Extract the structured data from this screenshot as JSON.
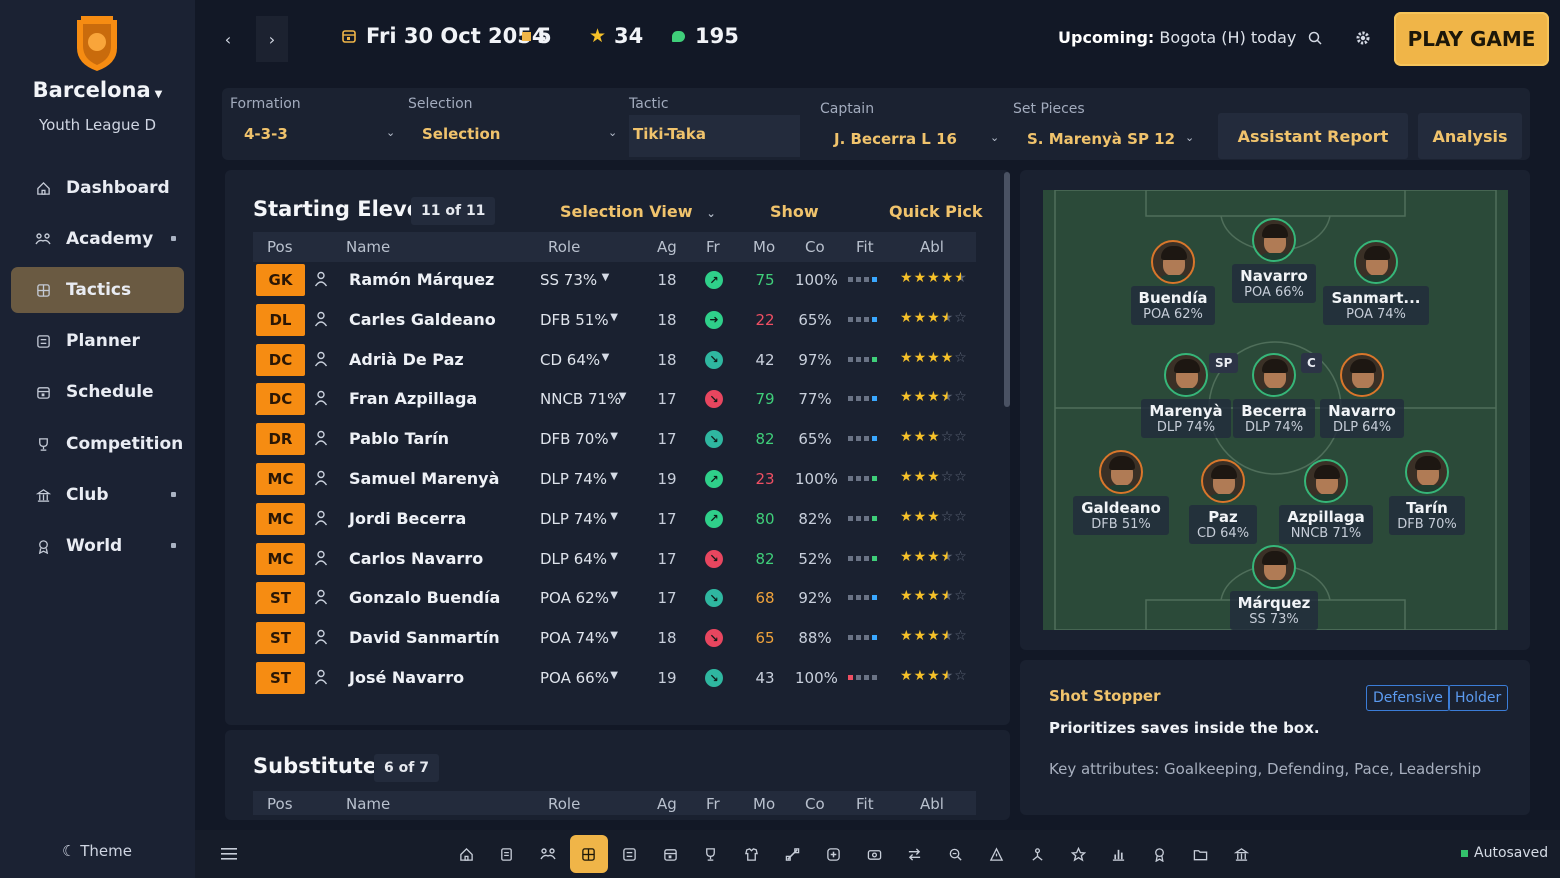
{
  "sidebar": {
    "club_name": "Barcelona",
    "league": "Youth League D",
    "nav": [
      {
        "label": "Dashboard",
        "icon": "home-icon",
        "active": false,
        "dot": false
      },
      {
        "label": "Academy",
        "icon": "academy-icon",
        "active": false,
        "dot": true
      },
      {
        "label": "Tactics",
        "icon": "tactics-icon",
        "active": true,
        "dot": false
      },
      {
        "label": "Planner",
        "icon": "planner-icon",
        "active": false,
        "dot": false
      },
      {
        "label": "Schedule",
        "icon": "calendar-icon",
        "active": false,
        "dot": false
      },
      {
        "label": "Competition",
        "icon": "trophy-icon",
        "active": false,
        "dot": false
      },
      {
        "label": "Club",
        "icon": "club-icon",
        "active": false,
        "dot": true
      },
      {
        "label": "World",
        "icon": "world-icon",
        "active": false,
        "dot": true
      }
    ],
    "theme_label": "Theme"
  },
  "topbar": {
    "date": "Fri 30 Oct 2054",
    "stat_squares": "5",
    "stat_stars": "34",
    "stat_coins": "195",
    "upcoming_label": "Upcoming:",
    "upcoming_value": "Bogota (H) today",
    "play_label": "PLAY GAME"
  },
  "toolbar": {
    "formation_label": "Formation",
    "formation_value": "4-3-3",
    "selection_label": "Selection",
    "selection_value": "Selection",
    "tactic_label": "Tactic",
    "tactic_value": "Tiki-Taka",
    "captain_label": "Captain",
    "captain_value": "J. Becerra  L 16",
    "setpieces_label": "Set Pieces",
    "setpieces_value": "S. Marenyà  SP 12",
    "assistant_label": "Assistant Report",
    "analysis_label": "Analysis"
  },
  "starting": {
    "title": "Starting Eleven",
    "count": "11 of 11",
    "selection_view": "Selection View",
    "show": "Show",
    "quick_pick": "Quick Pick",
    "columns": [
      "Pos",
      "Name",
      "Role",
      "Ag",
      "Fr",
      "Mo",
      "Co",
      "Fit",
      "Abl"
    ],
    "rows": [
      {
        "pos": "GK",
        "name": "Ramón Márquez",
        "role": "SS 73%",
        "age": "18",
        "form": "up",
        "morale": "75",
        "morale_color": "#3fcf7a",
        "cond": "100%",
        "fit_color": "#3aa8ff",
        "stars": 4.5
      },
      {
        "pos": "DL",
        "name": "Carles Galdeano",
        "role": "DFB 51%",
        "age": "18",
        "form": "right",
        "morale": "22",
        "morale_color": "#ef4f63",
        "cond": "65%",
        "fit_color": "#3aa8ff",
        "stars": 3.5
      },
      {
        "pos": "DC",
        "name": "Adrià De Paz",
        "role": "CD 64%",
        "age": "18",
        "form": "down-right",
        "morale": "42",
        "morale_color": "#c9d0dc",
        "cond": "97%",
        "fit_color": "#3fcf7a",
        "stars": 4
      },
      {
        "pos": "DC",
        "name": "Fran Azpillaga",
        "role": "NNCB 71%",
        "age": "17",
        "form": "down",
        "morale": "79",
        "morale_color": "#3fcf7a",
        "cond": "77%",
        "fit_color": "#3aa8ff",
        "stars": 3.5
      },
      {
        "pos": "DR",
        "name": "Pablo Tarín",
        "role": "DFB 70%",
        "age": "17",
        "form": "down-right",
        "morale": "82",
        "morale_color": "#3fcf7a",
        "cond": "65%",
        "fit_color": "#3aa8ff",
        "stars": 3
      },
      {
        "pos": "MC",
        "name": "Samuel Marenyà",
        "role": "DLP 74%",
        "age": "19",
        "form": "up",
        "morale": "23",
        "morale_color": "#ef4f63",
        "cond": "100%",
        "fit_color": "#3fcf7a",
        "stars": 3
      },
      {
        "pos": "MC",
        "name": "Jordi Becerra",
        "role": "DLP 74%",
        "age": "17",
        "form": "up",
        "morale": "80",
        "morale_color": "#3fcf7a",
        "cond": "82%",
        "fit_color": "#3fcf7a",
        "stars": 3
      },
      {
        "pos": "MC",
        "name": "Carlos Navarro",
        "role": "DLP 64%",
        "age": "17",
        "form": "down",
        "morale": "82",
        "morale_color": "#3fcf7a",
        "cond": "52%",
        "fit_color": "#3fcf7a",
        "stars": 3.5
      },
      {
        "pos": "ST",
        "name": "Gonzalo Buendía",
        "role": "POA 62%",
        "age": "17",
        "form": "down-right",
        "morale": "68",
        "morale_color": "#f0a33b",
        "cond": "92%",
        "fit_color": "#3aa8ff",
        "stars": 3.5
      },
      {
        "pos": "ST",
        "name": "David Sanmartín",
        "role": "POA 74%",
        "age": "18",
        "form": "down",
        "morale": "65",
        "morale_color": "#f0a33b",
        "cond": "88%",
        "fit_color": "#3aa8ff",
        "stars": 3.5
      },
      {
        "pos": "ST",
        "name": "José Navarro",
        "role": "POA 66%",
        "age": "19",
        "form": "down-right",
        "morale": "43",
        "morale_color": "#c9d0dc",
        "cond": "100%",
        "fit_color": "#ef4f63",
        "stars": 3.5
      }
    ]
  },
  "substitutes": {
    "title": "Substitutes",
    "count": "6 of 7",
    "columns": [
      "Pos",
      "Name",
      "Role",
      "Ag",
      "Fr",
      "Mo",
      "Co",
      "Fit",
      "Abl"
    ]
  },
  "pitch": {
    "players": [
      {
        "name": "Navarro",
        "role": "POA 66%",
        "ring": "good",
        "badge": ""
      },
      {
        "name": "Buendía",
        "role": "POA 62%",
        "ring": "warn",
        "badge": ""
      },
      {
        "name": "Sanmart...",
        "role": "POA 74%",
        "ring": "good",
        "badge": ""
      },
      {
        "name": "Marenyà",
        "role": "DLP 74%",
        "ring": "good",
        "badge": "SP"
      },
      {
        "name": "Becerra",
        "role": "DLP 74%",
        "ring": "good",
        "badge": "C"
      },
      {
        "name": "Navarro",
        "role": "DLP 64%",
        "ring": "warn",
        "badge": ""
      },
      {
        "name": "Galdeano",
        "role": "DFB 51%",
        "ring": "warn",
        "badge": ""
      },
      {
        "name": "Paz",
        "role": "CD 64%",
        "ring": "warn",
        "badge": ""
      },
      {
        "name": "Azpillaga",
        "role": "NNCB 71%",
        "ring": "good",
        "badge": ""
      },
      {
        "name": "Tarín",
        "role": "DFB 70%",
        "ring": "good",
        "badge": ""
      },
      {
        "name": "Márquez",
        "role": "SS 73%",
        "ring": "good",
        "badge": ""
      }
    ]
  },
  "role_info": {
    "title": "Shot Stopper",
    "tags": [
      "Defensive",
      "Holder"
    ],
    "description": "Prioritizes saves inside the box.",
    "key_attributes": "Key attributes: Goalkeeping, Defending, Pace, Leadership"
  },
  "bottombar": {
    "icons": [
      "home-icon",
      "document-icon",
      "academy-icon",
      "tactics-icon",
      "planner-icon",
      "calendar-icon",
      "trophy-icon",
      "kit-icon",
      "training-icon",
      "medical-icon",
      "finance-icon",
      "transfer-icon",
      "scout-icon",
      "staff-icon",
      "youth-icon",
      "star-icon",
      "stats-icon",
      "award-icon",
      "folder-icon",
      "club-icon"
    ],
    "autosaved": "Autosaved"
  },
  "colors": {
    "accent": "#f0b548",
    "position_badge": "#f68c12",
    "pitch": "#2c4a3a"
  }
}
